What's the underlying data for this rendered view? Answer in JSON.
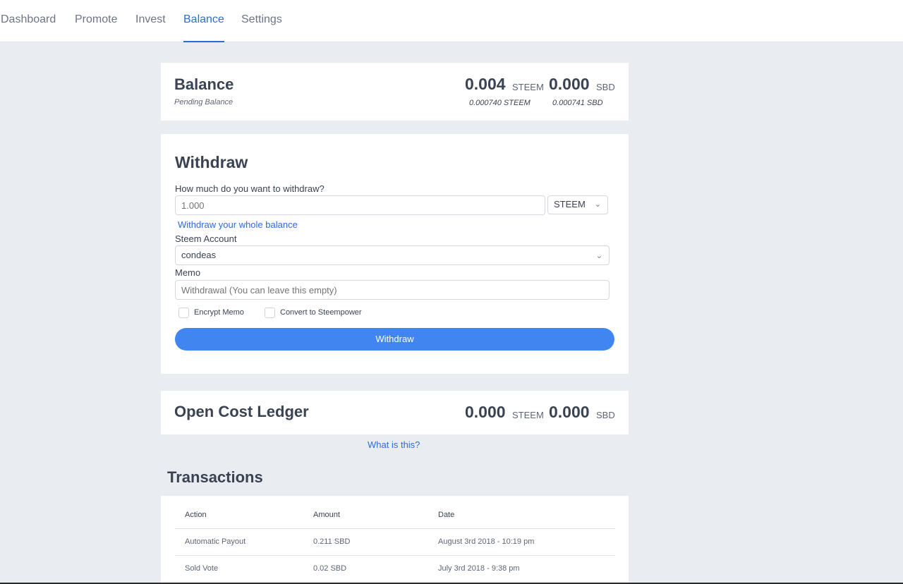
{
  "nav": {
    "tabs": [
      {
        "label": "Dashboard"
      },
      {
        "label": "Promote"
      },
      {
        "label": "Invest"
      },
      {
        "label": "Balance"
      },
      {
        "label": "Settings"
      }
    ],
    "active": "Balance"
  },
  "balance": {
    "title": "Balance",
    "subtitle": "Pending Balance",
    "steem_amount": "0.004",
    "steem_unit": "STEEM",
    "sbd_amount": "0.000",
    "sbd_unit": "SBD",
    "steem_pending": "0.000740 STEEM",
    "sbd_pending": "0.000741 SBD"
  },
  "withdraw": {
    "title": "Withdraw",
    "amount_label": "How much do you want to withdraw?",
    "amount_placeholder": "1.000",
    "currency_selected": "STEEM",
    "whole_balance_link": "Withdraw your whole balance",
    "account_label": "Steem Account",
    "account_selected": "condeas",
    "memo_label": "Memo",
    "memo_placeholder": "Withdrawal (You can leave this empty)",
    "encrypt_memo_label": "Encrypt Memo",
    "convert_label": "Convert to Steempower",
    "encrypt_checked": false,
    "convert_checked": false,
    "button_label": "Withdraw"
  },
  "ledger": {
    "title": "Open Cost Ledger",
    "steem_amount": "0.000",
    "steem_unit": "STEEM",
    "sbd_amount": "0.000",
    "sbd_unit": "SBD",
    "what_link": "What is this?"
  },
  "transactions": {
    "title": "Transactions",
    "columns": [
      "Action",
      "Amount",
      "Date"
    ],
    "rows": [
      {
        "action": "Automatic Payout",
        "amount": "0.211 SBD",
        "date": "August 3rd 2018 - 10:19 pm"
      },
      {
        "action": "Sold Vote",
        "amount": "0.02 SBD",
        "date": "July 3rd 2018 - 9:38 pm"
      }
    ]
  },
  "colors": {
    "accent": "#2d6cd6",
    "button": "#4186f0",
    "background": "#e9edf1"
  }
}
